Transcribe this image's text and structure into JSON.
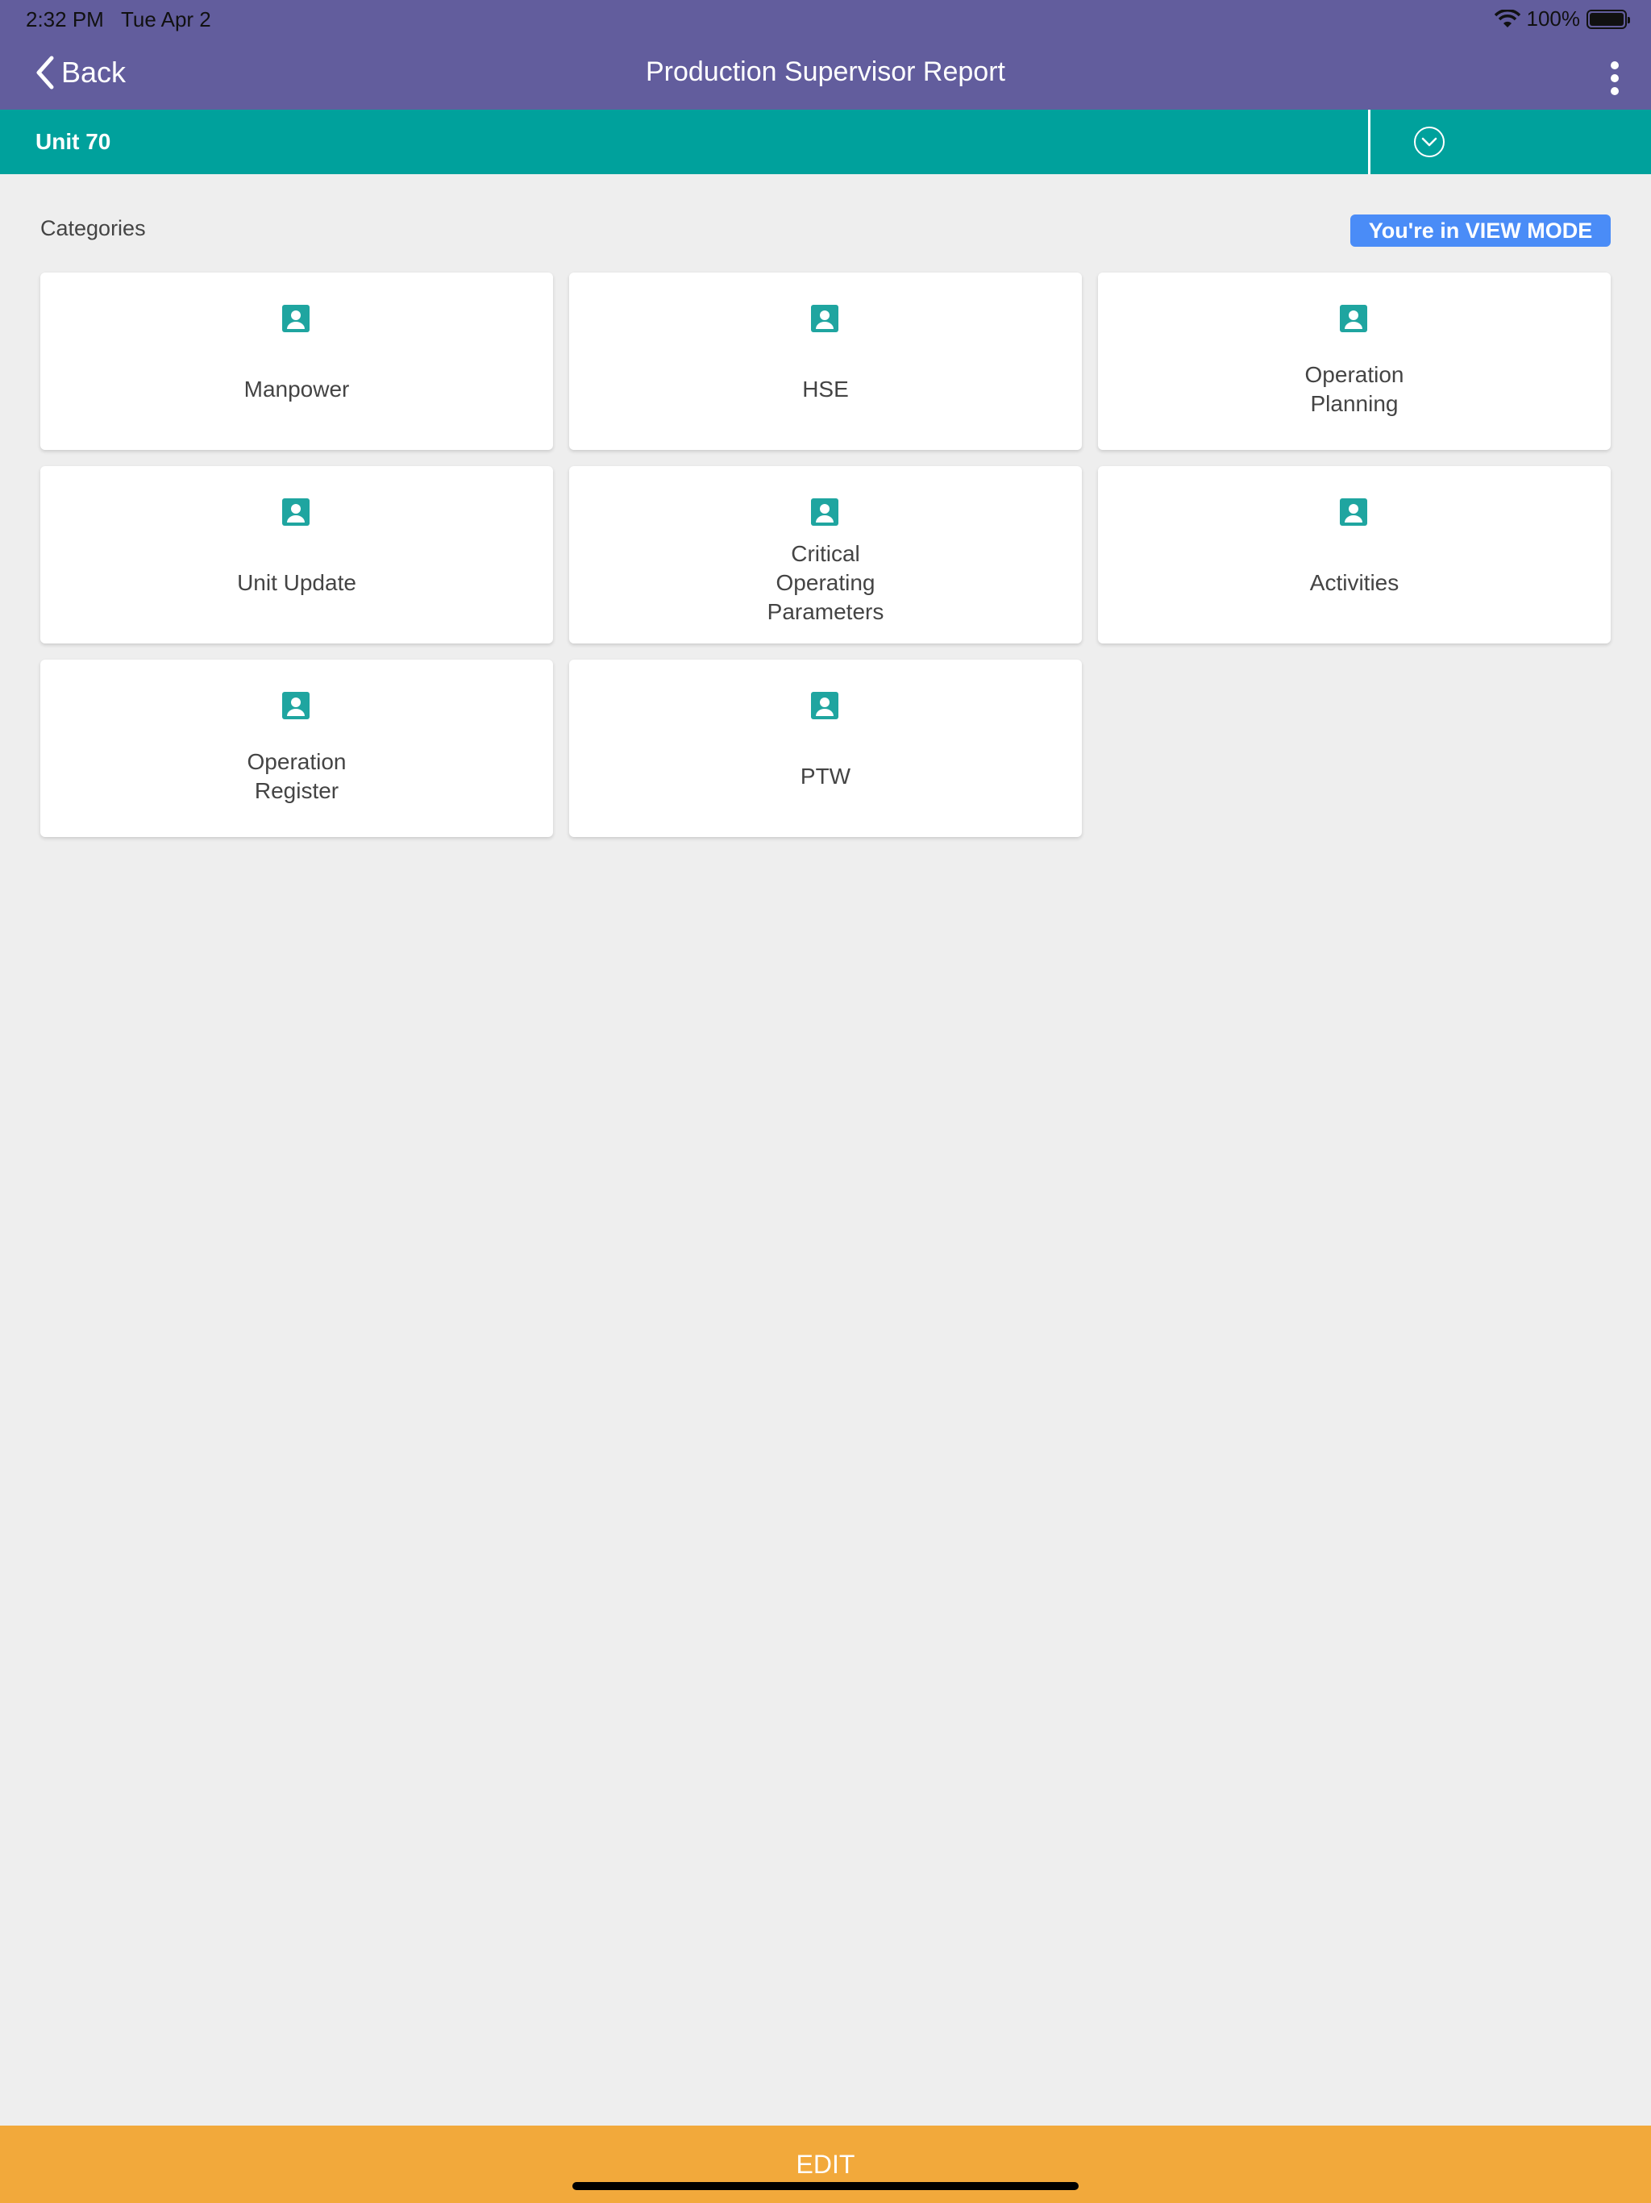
{
  "status_bar": {
    "time": "2:32 PM",
    "date": "Tue Apr 2",
    "battery": "100%"
  },
  "nav": {
    "back_label": "Back",
    "title": "Production Supervisor Report"
  },
  "unit": {
    "label": "Unit 70"
  },
  "section": {
    "title": "Categories",
    "mode_badge": "You're in VIEW MODE"
  },
  "categories": [
    {
      "label": "Manpower"
    },
    {
      "label": "HSE"
    },
    {
      "label": "Operation\nPlanning"
    },
    {
      "label": "Unit Update"
    },
    {
      "label": "Critical\nOperating\nParameters"
    },
    {
      "label": "Activities"
    },
    {
      "label": "Operation\nRegister"
    },
    {
      "label": "PTW"
    }
  ],
  "footer": {
    "edit_label": "EDIT"
  },
  "colors": {
    "header": "#625d9d",
    "unit_bar": "#00a19c",
    "badge": "#4a8cf7",
    "edit_bar": "#f2a93b",
    "icon": "#1fa5a0"
  }
}
